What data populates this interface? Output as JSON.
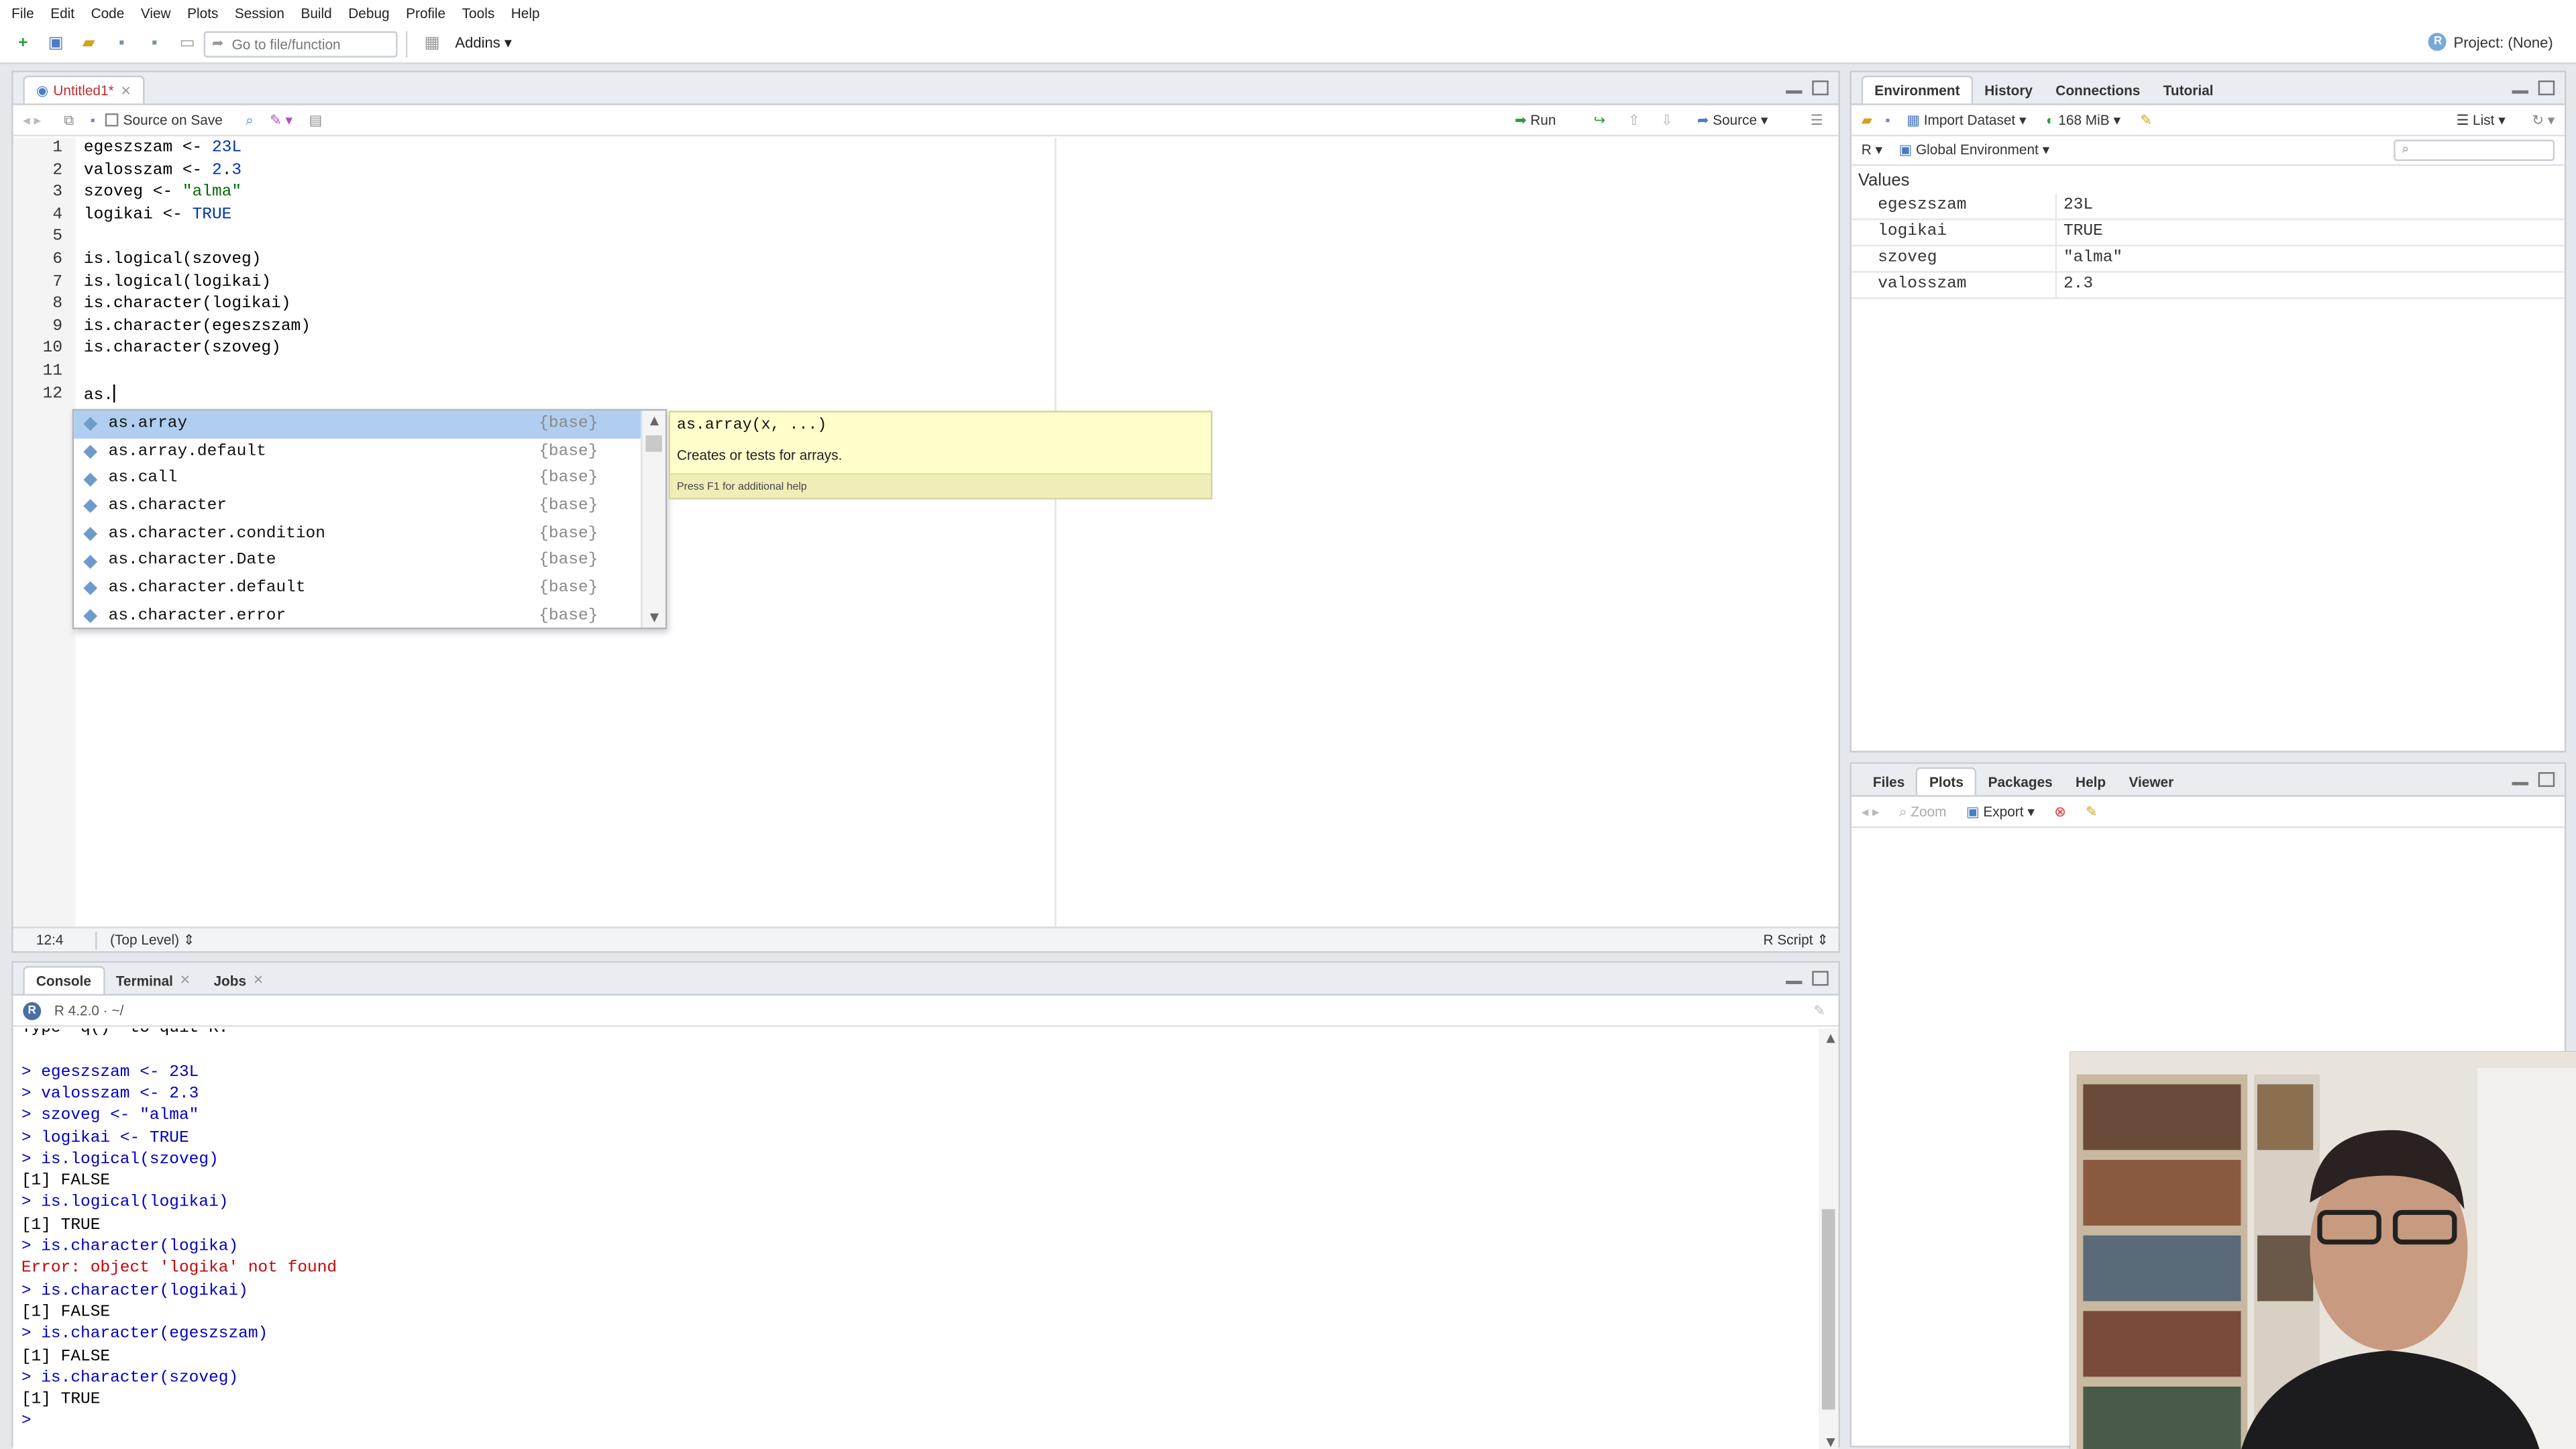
{
  "menu": [
    "File",
    "Edit",
    "Code",
    "View",
    "Plots",
    "Session",
    "Build",
    "Debug",
    "Profile",
    "Tools",
    "Help"
  ],
  "toolbar": {
    "goto_placeholder": "Go to file/function",
    "addins": "Addins",
    "project": "Project: (None)"
  },
  "editor": {
    "tab": "Untitled1*",
    "source_on_save": "Source on Save",
    "run": "Run",
    "source": "Source",
    "lines": [
      "egeszszam <- 23L",
      "valosszam <- 2.3",
      "szoveg <- \"alma\"",
      "logikai <- TRUE",
      "",
      "is.logical(szoveg)",
      "is.logical(logikai)",
      "is.character(logikai)",
      "is.character(egeszszam)",
      "is.character(szoveg)",
      "",
      "as."
    ],
    "line_numbers": [
      "1",
      "2",
      "3",
      "4",
      "5",
      "6",
      "7",
      "8",
      "9",
      "10",
      "11",
      "12"
    ],
    "status_pos": "12:4",
    "status_scope": "(Top Level)",
    "status_type": "R Script"
  },
  "autocomplete": {
    "items": [
      {
        "name": "as.array",
        "src": "{base}"
      },
      {
        "name": "as.array.default",
        "src": "{base}"
      },
      {
        "name": "as.call",
        "src": "{base}"
      },
      {
        "name": "as.character",
        "src": "{base}"
      },
      {
        "name": "as.character.condition",
        "src": "{base}"
      },
      {
        "name": "as.character.Date",
        "src": "{base}"
      },
      {
        "name": "as.character.default",
        "src": "{base}"
      },
      {
        "name": "as.character.error",
        "src": "{base}"
      }
    ],
    "tip_signature": "as.array(x, ...)",
    "tip_description": "Creates or tests for arrays.",
    "tip_footer": "Press F1 for additional help"
  },
  "console": {
    "tabs": [
      "Console",
      "Terminal",
      "Jobs"
    ],
    "version": "R 4.2.0 · ~/",
    "lines": [
      {
        "t": "Type 'q()' to quit R.",
        "k": "cout"
      },
      {
        "t": "",
        "k": "cout"
      },
      {
        "t": "> egeszszam <- 23L",
        "k": "cin"
      },
      {
        "t": "> valosszam <- 2.3",
        "k": "cin"
      },
      {
        "t": "> szoveg <- \"alma\"",
        "k": "cin"
      },
      {
        "t": "> logikai <- TRUE",
        "k": "cin"
      },
      {
        "t": "> is.logical(szoveg)",
        "k": "cin"
      },
      {
        "t": "[1] FALSE",
        "k": "cout"
      },
      {
        "t": "> is.logical(logikai)",
        "k": "cin"
      },
      {
        "t": "[1] TRUE",
        "k": "cout"
      },
      {
        "t": "> is.character(logika)",
        "k": "cin"
      },
      {
        "t": "Error: object 'logika' not found",
        "k": "cerr"
      },
      {
        "t": "> is.character(logikai)",
        "k": "cin"
      },
      {
        "t": "[1] FALSE",
        "k": "cout"
      },
      {
        "t": "> is.character(egeszszam)",
        "k": "cin"
      },
      {
        "t": "[1] FALSE",
        "k": "cout"
      },
      {
        "t": "> is.character(szoveg)",
        "k": "cin"
      },
      {
        "t": "[1] TRUE",
        "k": "cout"
      },
      {
        "t": "> ",
        "k": "cin"
      }
    ]
  },
  "environment": {
    "tabs": [
      "Environment",
      "History",
      "Connections",
      "Tutorial"
    ],
    "import": "Import Dataset",
    "memory": "168 MiB",
    "view": "List",
    "lang": "R",
    "scope": "Global Environment",
    "section": "Values",
    "values": [
      {
        "name": "egeszszam",
        "value": "23L"
      },
      {
        "name": "logikai",
        "value": "TRUE"
      },
      {
        "name": "szoveg",
        "value": "\"alma\""
      },
      {
        "name": "valosszam",
        "value": "2.3"
      }
    ]
  },
  "files": {
    "tabs": [
      "Files",
      "Plots",
      "Packages",
      "Help",
      "Viewer"
    ],
    "zoom": "Zoom",
    "export": "Export"
  }
}
